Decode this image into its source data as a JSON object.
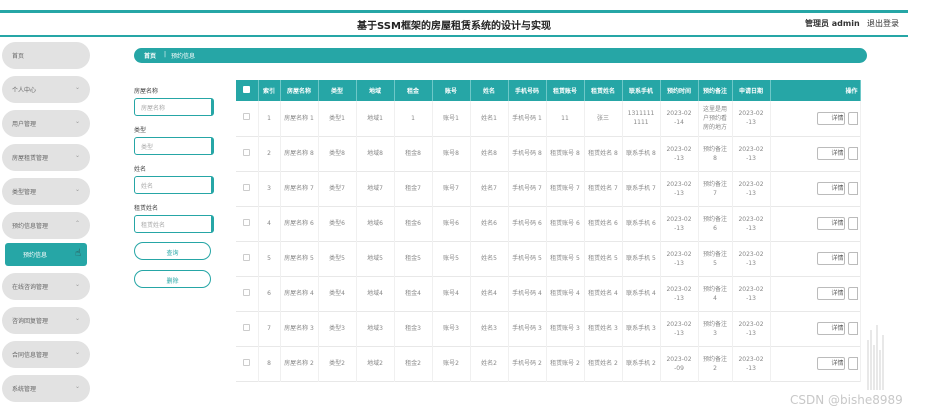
{
  "header": {
    "title": "基于SSM框架的房屋租赁系统的设计与实现",
    "admin": "管理员 admin",
    "logout": "退出登录"
  },
  "sidebar": {
    "items": [
      {
        "label": "首页",
        "chevron": ""
      },
      {
        "label": "个人中心",
        "chevron": "⌄"
      },
      {
        "label": "用户管理",
        "chevron": "⌄"
      },
      {
        "label": "房屋租赁管理",
        "chevron": "⌄"
      },
      {
        "label": "类型管理",
        "chevron": "⌄"
      },
      {
        "label": "预约信息管理",
        "chevron": "⌃"
      },
      {
        "label": "预约信息",
        "chevron": ""
      },
      {
        "label": "在线咨询管理",
        "chevron": "⌄"
      },
      {
        "label": "咨询回复管理",
        "chevron": "⌄"
      },
      {
        "label": "合同信息管理",
        "chevron": "⌄"
      },
      {
        "label": "系统管理",
        "chevron": "⌄"
      }
    ]
  },
  "breadcrumb": {
    "home": "首页",
    "sep": "|",
    "current": "预约信息"
  },
  "filters": {
    "house_name_label": "房屋名称",
    "house_name_placeholder": "房屋名称",
    "type_label": "类型",
    "type_placeholder": "类型",
    "name_label": "姓名",
    "name_placeholder": "姓名",
    "tenant_label": "租赁姓名",
    "tenant_placeholder": "租赁姓名",
    "search_btn": "查询",
    "delete_btn": "删除"
  },
  "table": {
    "headers": [
      "索引",
      "房屋名称",
      "类型",
      "地域",
      "租金",
      "账号",
      "姓名",
      "手机号码",
      "租赁账号",
      "租赁姓名",
      "联系手机",
      "预约时间",
      "预约备注",
      "申请日期",
      "操作"
    ],
    "detail_label": "详情",
    "rows": [
      [
        "1",
        "房屋名称 1",
        "类型1",
        "地域1",
        "1",
        "账号1",
        "姓名1",
        "手机号码 1",
        "11",
        "张三",
        "1311111 1111",
        "2023-02 -14",
        "这里是用户预约看房的地方",
        "2023-02 -13"
      ],
      [
        "2",
        "房屋名称 8",
        "类型8",
        "地域8",
        "租金8",
        "账号8",
        "姓名8",
        "手机号码 8",
        "租赁账号 8",
        "租赁姓名 8",
        "联系手机 8",
        "2023-02 -13",
        "预约备注 8",
        "2023-02 -13"
      ],
      [
        "3",
        "房屋名称 7",
        "类型7",
        "地域7",
        "租金7",
        "账号7",
        "姓名7",
        "手机号码 7",
        "租赁账号 7",
        "租赁姓名 7",
        "联系手机 7",
        "2023-02 -13",
        "预约备注 7",
        "2023-02 -13"
      ],
      [
        "4",
        "房屋名称 6",
        "类型6",
        "地域6",
        "租金6",
        "账号6",
        "姓名6",
        "手机号码 6",
        "租赁账号 6",
        "租赁姓名 6",
        "联系手机 6",
        "2023-02 -13",
        "预约备注 6",
        "2023-02 -13"
      ],
      [
        "5",
        "房屋名称 5",
        "类型5",
        "地域5",
        "租金5",
        "账号5",
        "姓名5",
        "手机号码 5",
        "租赁账号 5",
        "租赁姓名 5",
        "联系手机 5",
        "2023-02 -13",
        "预约备注 5",
        "2023-02 -13"
      ],
      [
        "6",
        "房屋名称 4",
        "类型4",
        "地域4",
        "租金4",
        "账号4",
        "姓名4",
        "手机号码 4",
        "租赁账号 4",
        "租赁姓名 4",
        "联系手机 4",
        "2023-02 -13",
        "预约备注 4",
        "2023-02 -13"
      ],
      [
        "7",
        "房屋名称 3",
        "类型3",
        "地域3",
        "租金3",
        "账号3",
        "姓名3",
        "手机号码 3",
        "租赁账号 3",
        "租赁姓名 3",
        "联系手机 3",
        "2023-02 -13",
        "预约备注 3",
        "2023-02 -13"
      ],
      [
        "8",
        "房屋名称 2",
        "类型2",
        "地域2",
        "租金2",
        "账号2",
        "姓名2",
        "手机号码 2",
        "租赁账号 2",
        "租赁姓名 2",
        "联系手机 2",
        "2023-02 -09",
        "预约备注 2",
        "2023-02 -13"
      ]
    ]
  },
  "watermark": "CSDN @bishe8989",
  "colors": {
    "accent": "#26a6a6"
  }
}
